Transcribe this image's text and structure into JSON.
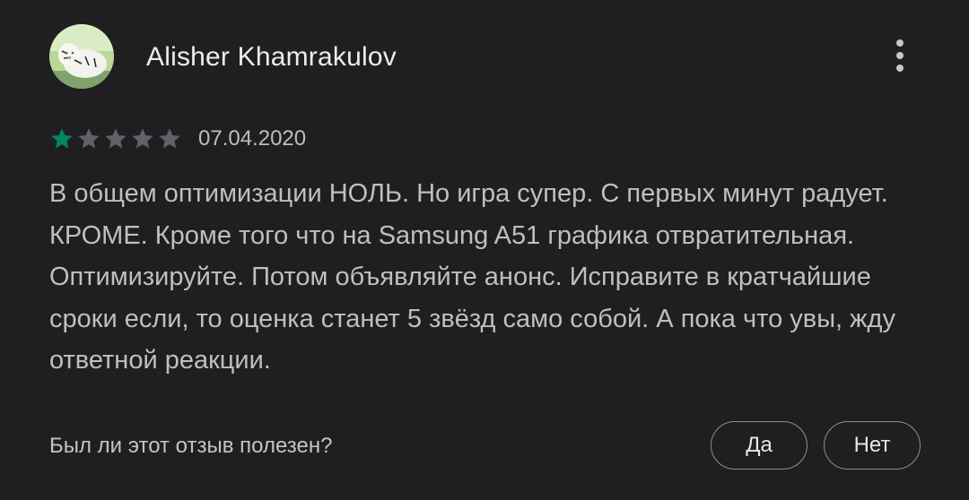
{
  "review": {
    "author_name": "Alisher Khamrakulov",
    "avatar_icon": "tiger-avatar",
    "more_icon": "more-vert-icon",
    "rating": 1,
    "max_rating": 5,
    "date": "07.04.2020",
    "text": "В общем оптимизации НОЛЬ. Но игра супер. С первых минут радует. КРОМЕ. Кроме того что на Samsung A51 графика отвратительная. Оптимизируйте. Потом объявляйте анонс. Исправите в кратчайшие сроки если, то оценка станет 5 звёзд само собой. А пока что увы, жду ответной реакции.",
    "helpful_question": "Был ли этот отзыв полезен?",
    "yes_label": "Да",
    "no_label": "Нет"
  },
  "colors": {
    "background": "#1f1f21",
    "star_filled": "#01875f",
    "star_empty": "#5f6368"
  }
}
